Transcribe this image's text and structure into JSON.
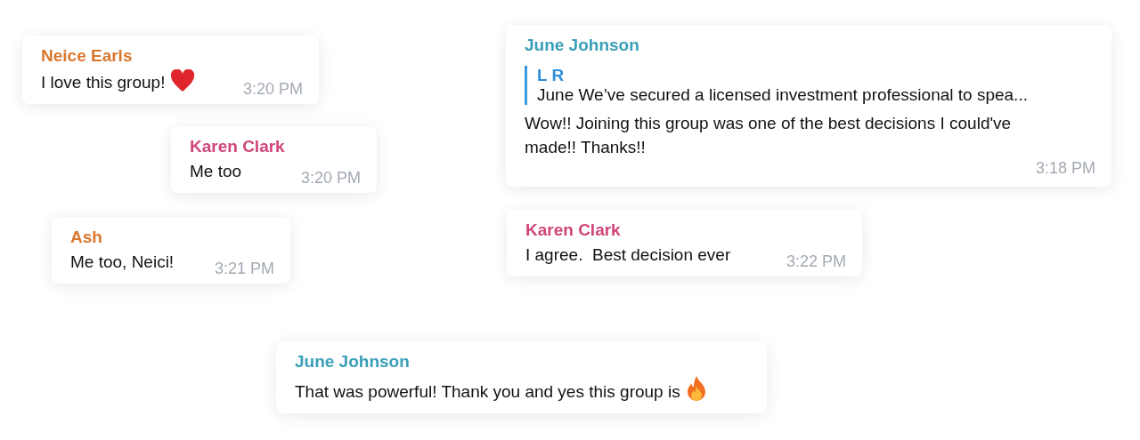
{
  "messages": [
    {
      "sender": "Neice Earls",
      "color": "#d9772f",
      "text": "I love this group!",
      "kind": "heart",
      "time": "3:20 PM"
    },
    {
      "sender": "Karen Clark",
      "color": "#d0457a",
      "text": "Me too",
      "time": "3:20 PM"
    },
    {
      "sender": "Ash",
      "color": "#d9772f",
      "text": "Me too, Neici!",
      "time": "3:21 PM"
    },
    {
      "sender": "June Johnson",
      "color": "#3a9fb8",
      "reply": {
        "sender": "L R",
        "text": "June We’ve secured a licensed investment professional to spea..."
      },
      "text": "Wow!! Joining this group was one of the best decisions I could've made!! Thanks!!",
      "time": "3:18 PM"
    },
    {
      "sender": "Karen Clark",
      "color": "#d0457a",
      "text": "I agree.  Best decision ever",
      "time": "3:22 PM"
    },
    {
      "sender": "June Johnson",
      "color": "#3a9fb8",
      "text": "That was powerful! Thank you and yes this group is",
      "kind": "fire"
    }
  ]
}
